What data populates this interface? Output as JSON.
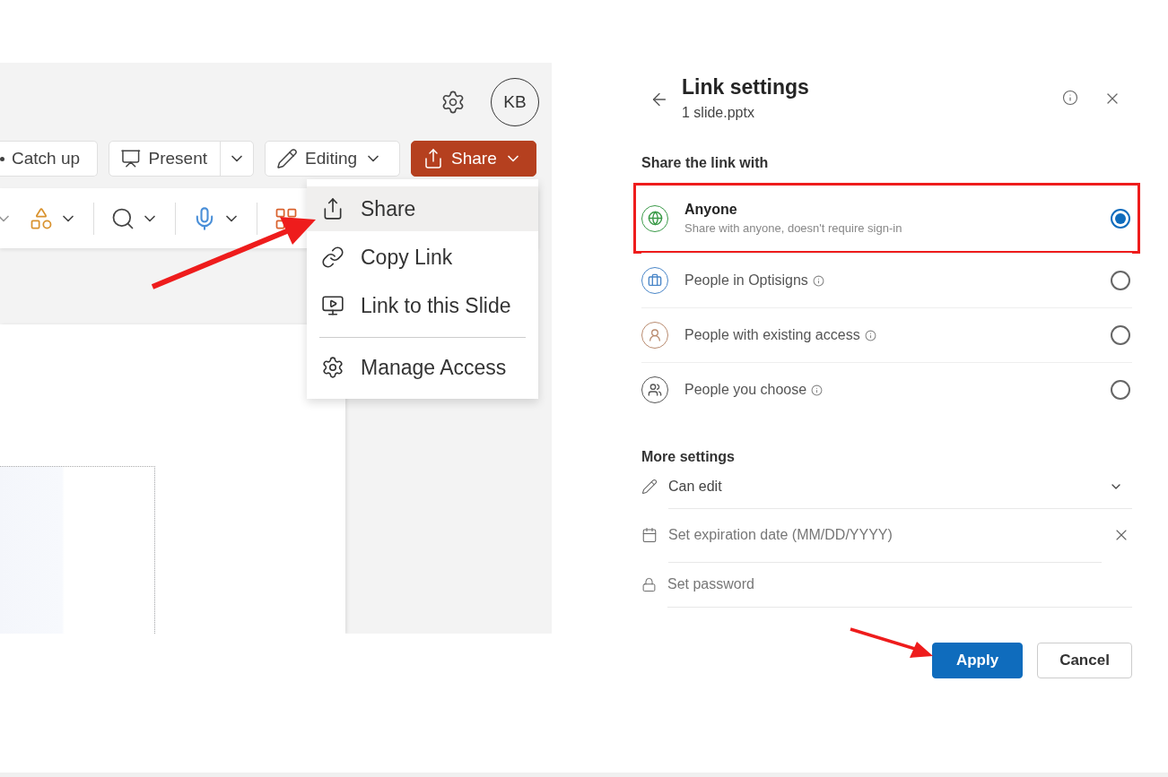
{
  "app": {
    "avatar_initials": "KB",
    "buttons": [
      {
        "kind": "catchup",
        "label": "Catch up"
      },
      {
        "kind": "split",
        "label": "Present"
      },
      {
        "kind": "dropdown",
        "label": "Editing"
      },
      {
        "kind": "primary",
        "label": "Share"
      }
    ]
  },
  "share_menu": {
    "items": [
      {
        "kind": "share",
        "label": "Share",
        "selected": true
      },
      {
        "kind": "link",
        "label": "Copy Link",
        "selected": false
      },
      {
        "kind": "slide",
        "label": "Link to this Slide",
        "selected": false
      },
      {
        "kind": "divider"
      },
      {
        "kind": "gear",
        "label": "Manage Access",
        "selected": false
      }
    ]
  },
  "dialog": {
    "title": "Link settings",
    "subtitle": "1 slide.pptx",
    "section_label": "Share the link with",
    "options": [
      {
        "kind": "globe",
        "label": "Anyone",
        "description": "Share with anyone, doesn't require sign-in",
        "selected": true,
        "annotated": true,
        "info": false,
        "color": "#3a9a48"
      },
      {
        "kind": "briefcase",
        "label": "People in Optisigns",
        "selected": false,
        "annotated": false,
        "info": true,
        "color": "#4a86c8"
      },
      {
        "kind": "person",
        "label": "People with existing access",
        "selected": false,
        "annotated": false,
        "info": true,
        "color": "#b98a6e"
      },
      {
        "kind": "people",
        "label": "People you choose",
        "selected": false,
        "annotated": false,
        "info": true,
        "color": "#555555"
      }
    ],
    "more_settings": {
      "label": "More settings",
      "permission": "Can edit",
      "expiration": {
        "placeholder": "Set expiration date (MM/DD/YYYY)"
      },
      "password": {
        "placeholder": "Set password"
      }
    },
    "actions": [
      {
        "kind": "primary",
        "label": "Apply"
      },
      {
        "kind": "secondary",
        "label": "Cancel"
      }
    ]
  }
}
